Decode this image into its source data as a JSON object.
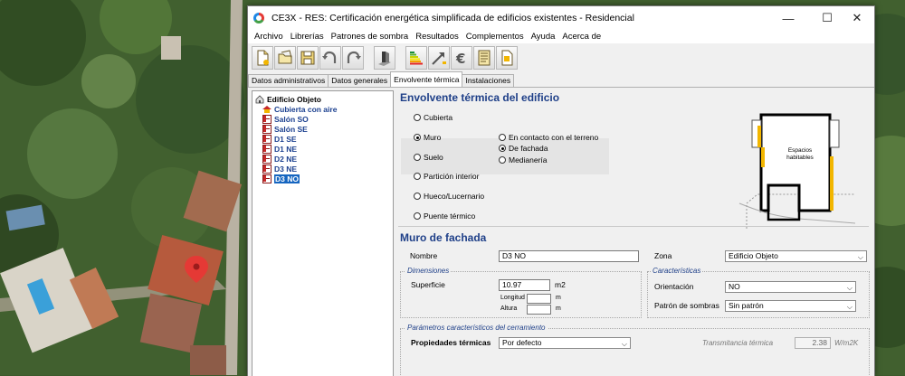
{
  "window": {
    "title": "CE3X - RES: Certificación energética simplificada de edificios existentes - Residencial",
    "minimize": "—",
    "maximize": "☐",
    "close": "✕"
  },
  "menu": [
    "Archivo",
    "Librerías",
    "Patrones de sombra",
    "Resultados",
    "Complementos",
    "Ayuda",
    "Acerca de"
  ],
  "toolbar": [
    "new-file-icon",
    "open-file-icon",
    "save-icon",
    "undo-icon",
    "redo-icon",
    "building-icon",
    "energy-rating-icon",
    "improvement-arrow-icon",
    "euro-icon",
    "report-icon",
    "certificate-icon"
  ],
  "tabs": [
    "Datos administrativos",
    "Datos generales",
    "Envolvente térmica",
    "Instalaciones"
  ],
  "active_tab": "Envolvente térmica",
  "tree": {
    "root": "Edificio Objeto",
    "items": [
      "Cubierta con aire",
      "Salón SO",
      "Salón SE",
      "D1 SE",
      "D1 NE",
      "D2 NE",
      "D3 NE",
      "D3 NO"
    ],
    "selected": "D3 NO"
  },
  "envolvente": {
    "title": "Envolvente térmica del edificio",
    "options": [
      "Cubierta",
      "Muro",
      "Suelo",
      "Partición interior",
      "Hueco/Lucernario",
      "Puente térmico"
    ],
    "selected": "Muro",
    "muro_options": [
      "En contacto con el terreno",
      "De fachada",
      "Medianería"
    ],
    "muro_selected": "De fachada",
    "diagram_label": "Espacios habitables"
  },
  "muro": {
    "title": "Muro de fachada",
    "nombre_label": "Nombre",
    "nombre_value": "D3 NO",
    "zona_label": "Zona",
    "zona_value": "Edificio Objeto",
    "dimensiones": {
      "label": "Dimensiones",
      "superficie_label": "Superficie",
      "superficie_value": "10.97",
      "superficie_unit": "m2",
      "longitud_label": "Longitud",
      "longitud_unit": "m",
      "altura_label": "Altura",
      "altura_unit": "m"
    },
    "caracteristicas": {
      "label": "Características",
      "orientacion_label": "Orientación",
      "orientacion_value": "NO",
      "patron_label": "Patrón de sombras",
      "patron_value": "Sin patrón"
    },
    "parametros": {
      "label": "Parámetros característicos del cerramiento",
      "propiedades_label": "Propiedades térmicas",
      "propiedades_value": "Por defecto",
      "transmitancia_label": "Transmitancia térmica",
      "transmitancia_value": "2.38",
      "transmitancia_unit": "W/m2K"
    }
  },
  "colors": {
    "accent_blue": "#1e3f88",
    "selection": "#1565c0",
    "wall_red": "#c62828",
    "window_yellow": "#f2b600"
  }
}
